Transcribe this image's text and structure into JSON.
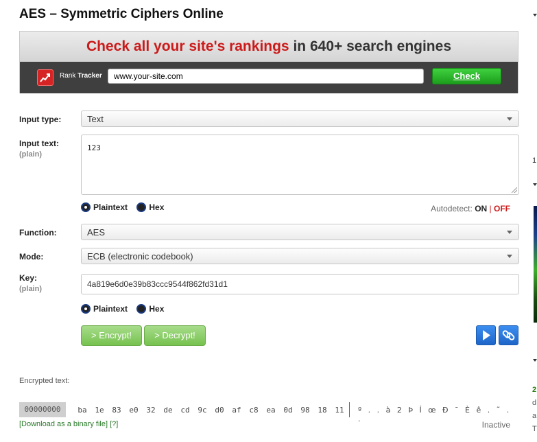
{
  "page": {
    "title": "AES – Symmetric Ciphers Online"
  },
  "ad": {
    "headline_red": "Check all your site's rankings",
    "headline_rest": " in 640+ search engines",
    "brand_rank": "Rank",
    "brand_tracker": "Tracker",
    "url_value": "www.your-site.com",
    "check_label": "Check"
  },
  "form": {
    "input_type": {
      "label": "Input type:",
      "value": "Text"
    },
    "input_text": {
      "label": "Input text:",
      "sub": "(plain)",
      "value": "123"
    },
    "input_format": {
      "plaintext": "Plaintext",
      "hex": "Hex",
      "selected": "plaintext"
    },
    "autodetect": {
      "label": "Autodetect:",
      "on": "ON",
      "sep": "|",
      "off": "OFF"
    },
    "function": {
      "label": "Function:",
      "value": "AES"
    },
    "mode": {
      "label": "Mode:",
      "value": "ECB (electronic codebook)"
    },
    "key": {
      "label": "Key:",
      "sub": "(plain)",
      "value": "4a819e6d0e39b83ccc9544f862fd31d1"
    },
    "key_format": {
      "plaintext": "Plaintext",
      "hex": "Hex",
      "selected": "plaintext"
    },
    "encrypt_label": "> Encrypt!",
    "decrypt_label": "> Decrypt!"
  },
  "output": {
    "label": "Encrypted text:",
    "offset": "00000000",
    "bytes": [
      "ba",
      "1e",
      "83",
      "e0",
      "32",
      "de",
      "cd",
      "9c",
      "d0",
      "af",
      "c8",
      "ea",
      "0d",
      "98",
      "18",
      "11"
    ],
    "ascii": "º . . à 2 Þ Í œ Ð ¯ È ê . ˜ . .",
    "download_label": "[Download as a binary file]",
    "help_label": "[?]",
    "status": "Inactive"
  },
  "sidebar": {
    "frag1": "1",
    "frag2": "2",
    "frag3": "d",
    "frag4": "a",
    "frag5": "T"
  },
  "colors": {
    "accent_red": "#cc1a1a",
    "green_button": "#76c24f",
    "blue_button": "#1e66c8"
  }
}
